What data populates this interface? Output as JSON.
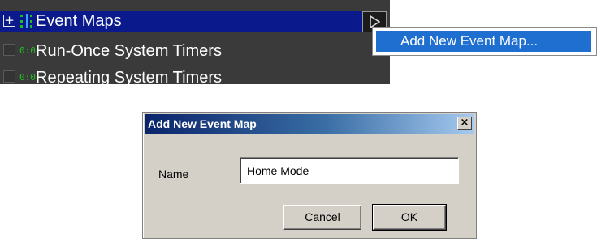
{
  "tree": {
    "items": [
      {
        "label": "Event Maps",
        "expander": "+",
        "icon": "event-map-icon",
        "selected": true
      },
      {
        "label": "Run-Once System Timers",
        "icon": "timer-icon",
        "icon_text": "0:0"
      },
      {
        "label": "Repeating System Timers",
        "icon": "timer-icon",
        "icon_text": "0:0"
      }
    ],
    "colors": {
      "panel_bg": "#3a3a3a",
      "selection_bg": "#0a1a8c",
      "timer_green": "#1fbf1f"
    }
  },
  "context_menu": {
    "items": [
      {
        "label": "Add New Event Map..."
      }
    ],
    "highlight_color": "#1e6fd0"
  },
  "dialog": {
    "title": "Add New Event Map",
    "close_glyph": "×",
    "name_label": "Name",
    "name_value": "Home Mode",
    "cancel_label": "Cancel",
    "ok_label": "OK",
    "colors": {
      "face": "#d4d0c8",
      "title_start": "#0a246a",
      "title_end": "#a6caf0"
    }
  }
}
